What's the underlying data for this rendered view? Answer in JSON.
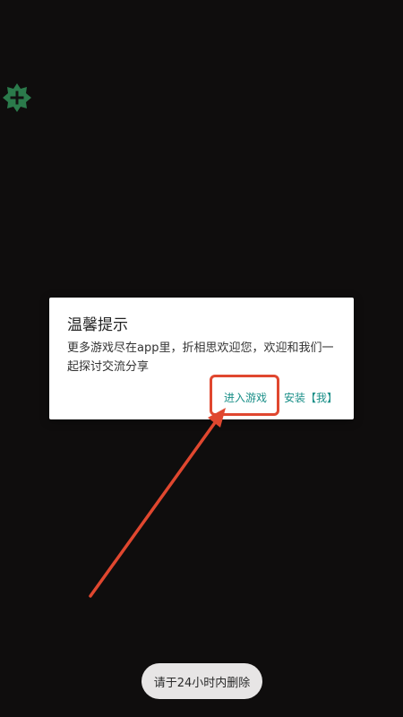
{
  "dialog": {
    "title": "温馨提示",
    "message": "更多游戏尽在app里，折相思欢迎您，欢迎和我们一起探讨交流分享",
    "enter_button": "进入游戏",
    "install_button": "安装【我】"
  },
  "toast": {
    "text": "请于24小时内删除"
  },
  "floating_button": {
    "icon": "plus-icon"
  },
  "colors": {
    "background": "#0f0d0d",
    "accent": "#1a8f88",
    "annotation": "#e0472f",
    "badge": "#2b7a4b"
  }
}
